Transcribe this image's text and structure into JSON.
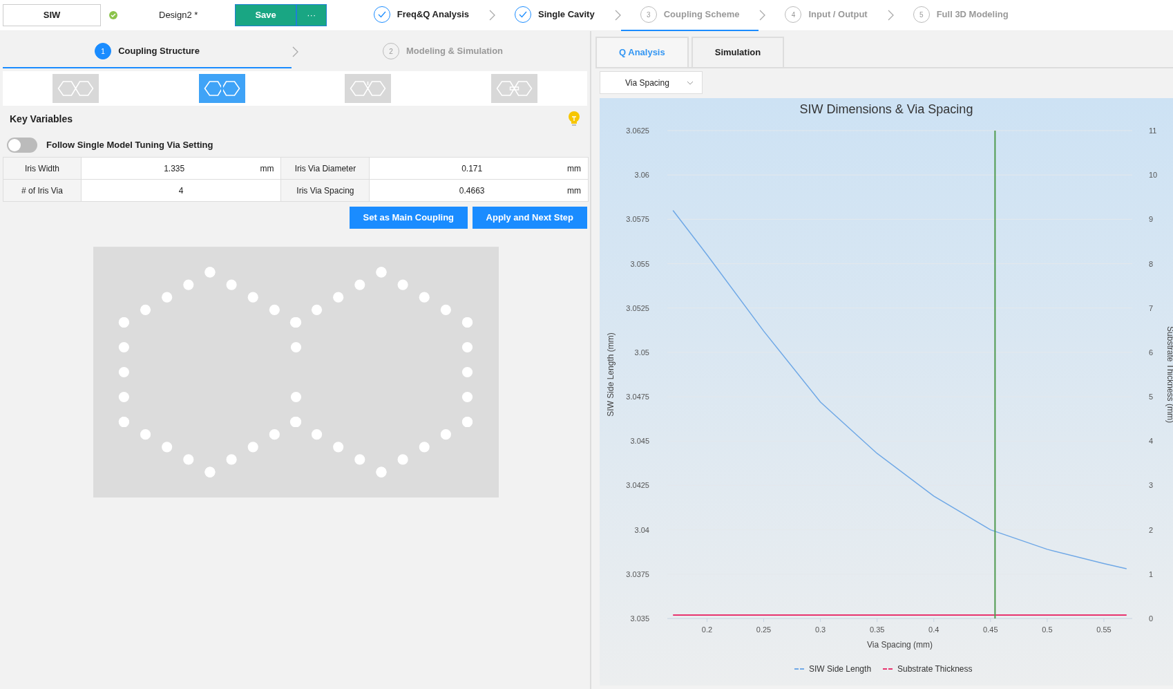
{
  "header": {
    "project": "SIW",
    "design": "Design2 *",
    "save": "Save",
    "more": "···",
    "steps": [
      {
        "label": "Freq&Q Analysis",
        "done": true,
        "selected": false
      },
      {
        "label": "Single Cavity",
        "done": true,
        "selected": false
      },
      {
        "number": "3",
        "label": "Coupling Scheme",
        "done": false,
        "selected": true
      },
      {
        "number": "4",
        "label": "Input / Output",
        "done": false,
        "selected": false
      },
      {
        "number": "5",
        "label": "Full 3D Modeling",
        "done": false,
        "selected": false
      }
    ]
  },
  "substeps": [
    {
      "number": "1",
      "label": "Coupling Structure",
      "selected": true
    },
    {
      "number": "2",
      "label": "Modeling & Simulation",
      "selected": false
    }
  ],
  "structures": [
    {
      "kind": "plain",
      "selected": false
    },
    {
      "kind": "iris",
      "selected": true
    },
    {
      "kind": "post",
      "selected": false
    },
    {
      "kind": "window",
      "selected": false
    }
  ],
  "key_variables": {
    "title": "Key Variables",
    "toggle": {
      "label": "Follow Single Model Tuning Via Setting",
      "on": false
    },
    "rows": [
      [
        {
          "label": "Iris Width",
          "value": "1.335",
          "unit": "mm"
        },
        {
          "label": "Iris Via Diameter",
          "value": "0.171",
          "unit": "mm"
        }
      ],
      [
        {
          "label": "# of Iris Via",
          "value": "4"
        },
        {
          "label": "Iris Via Spacing",
          "value": "0.4663",
          "unit": "mm"
        }
      ]
    ],
    "buttons": [
      "Set as Main Coupling",
      "Apply and Next Step"
    ]
  },
  "right_tabs": [
    {
      "label": "Q Analysis",
      "selected": true
    },
    {
      "label": "Simulation",
      "selected": false
    }
  ],
  "dropdown": {
    "value": "Via Spacing"
  },
  "chart_data": {
    "type": "line",
    "title": "SIW Dimensions & Via Spacing",
    "xlabel": "Via Spacing (mm)",
    "ylabel": "SIW Side Length (mm)",
    "y2label": "Substrate Thickness (mm)",
    "x": [
      0.17,
      0.2,
      0.25,
      0.3,
      0.35,
      0.4,
      0.45,
      0.5,
      0.55,
      0.57
    ],
    "series": [
      {
        "name": "SIW Side Length",
        "color": "#6fa8e6",
        "axis": "y",
        "values": [
          3.058,
          3.0555,
          3.0512,
          3.0472,
          3.0443,
          3.0419,
          3.04,
          3.0389,
          3.0381,
          3.0378
        ]
      },
      {
        "name": "Substrate Thickness",
        "color": "#e8336e",
        "axis": "y2",
        "values": [
          0.08,
          0.08,
          0.08,
          0.08,
          0.08,
          0.08,
          0.08,
          0.08,
          0.08,
          0.08
        ]
      }
    ],
    "xlim": [
      0.165,
      0.575
    ],
    "ylim": [
      3.035,
      3.0625
    ],
    "y2lim": [
      0,
      11
    ],
    "xticks": [
      {
        "value": 0.2,
        "label": "0.2"
      },
      {
        "value": 0.25,
        "label": "0.25"
      },
      {
        "value": 0.3,
        "label": "0.3"
      },
      {
        "value": 0.35,
        "label": "0.35"
      },
      {
        "value": 0.4,
        "label": "0.4"
      },
      {
        "value": 0.45,
        "label": "0.45"
      },
      {
        "value": 0.5,
        "label": "0.5"
      },
      {
        "value": 0.55,
        "label": "0.55"
      }
    ],
    "yticks": [
      {
        "value": 3.035,
        "label": "3.035"
      },
      {
        "value": 3.0375,
        "label": "3.0375"
      },
      {
        "value": 3.04,
        "label": "3.04"
      },
      {
        "value": 3.0425,
        "label": "3.0425"
      },
      {
        "value": 3.045,
        "label": "3.045"
      },
      {
        "value": 3.0475,
        "label": "3.0475"
      },
      {
        "value": 3.05,
        "label": "3.05"
      },
      {
        "value": 3.0525,
        "label": "3.0525"
      },
      {
        "value": 3.055,
        "label": "3.055"
      },
      {
        "value": 3.0575,
        "label": "3.0575"
      },
      {
        "value": 3.06,
        "label": "3.06"
      },
      {
        "value": 3.0625,
        "label": "3.0625"
      }
    ],
    "y2ticks": [
      {
        "value": 0,
        "label": "0"
      },
      {
        "value": 1,
        "label": "1"
      },
      {
        "value": 2,
        "label": "2"
      },
      {
        "value": 3,
        "label": "3"
      },
      {
        "value": 4,
        "label": "4"
      },
      {
        "value": 5,
        "label": "5"
      },
      {
        "value": 6,
        "label": "6"
      },
      {
        "value": 7,
        "label": "7"
      },
      {
        "value": 8,
        "label": "8"
      },
      {
        "value": 9,
        "label": "9"
      },
      {
        "value": 10,
        "label": "10"
      },
      {
        "value": 11,
        "label": "11"
      }
    ],
    "grid": true,
    "legend": true,
    "ref_lines": [
      {
        "axis": "x",
        "value": 0.454,
        "color": "#4f9a4f"
      }
    ]
  }
}
